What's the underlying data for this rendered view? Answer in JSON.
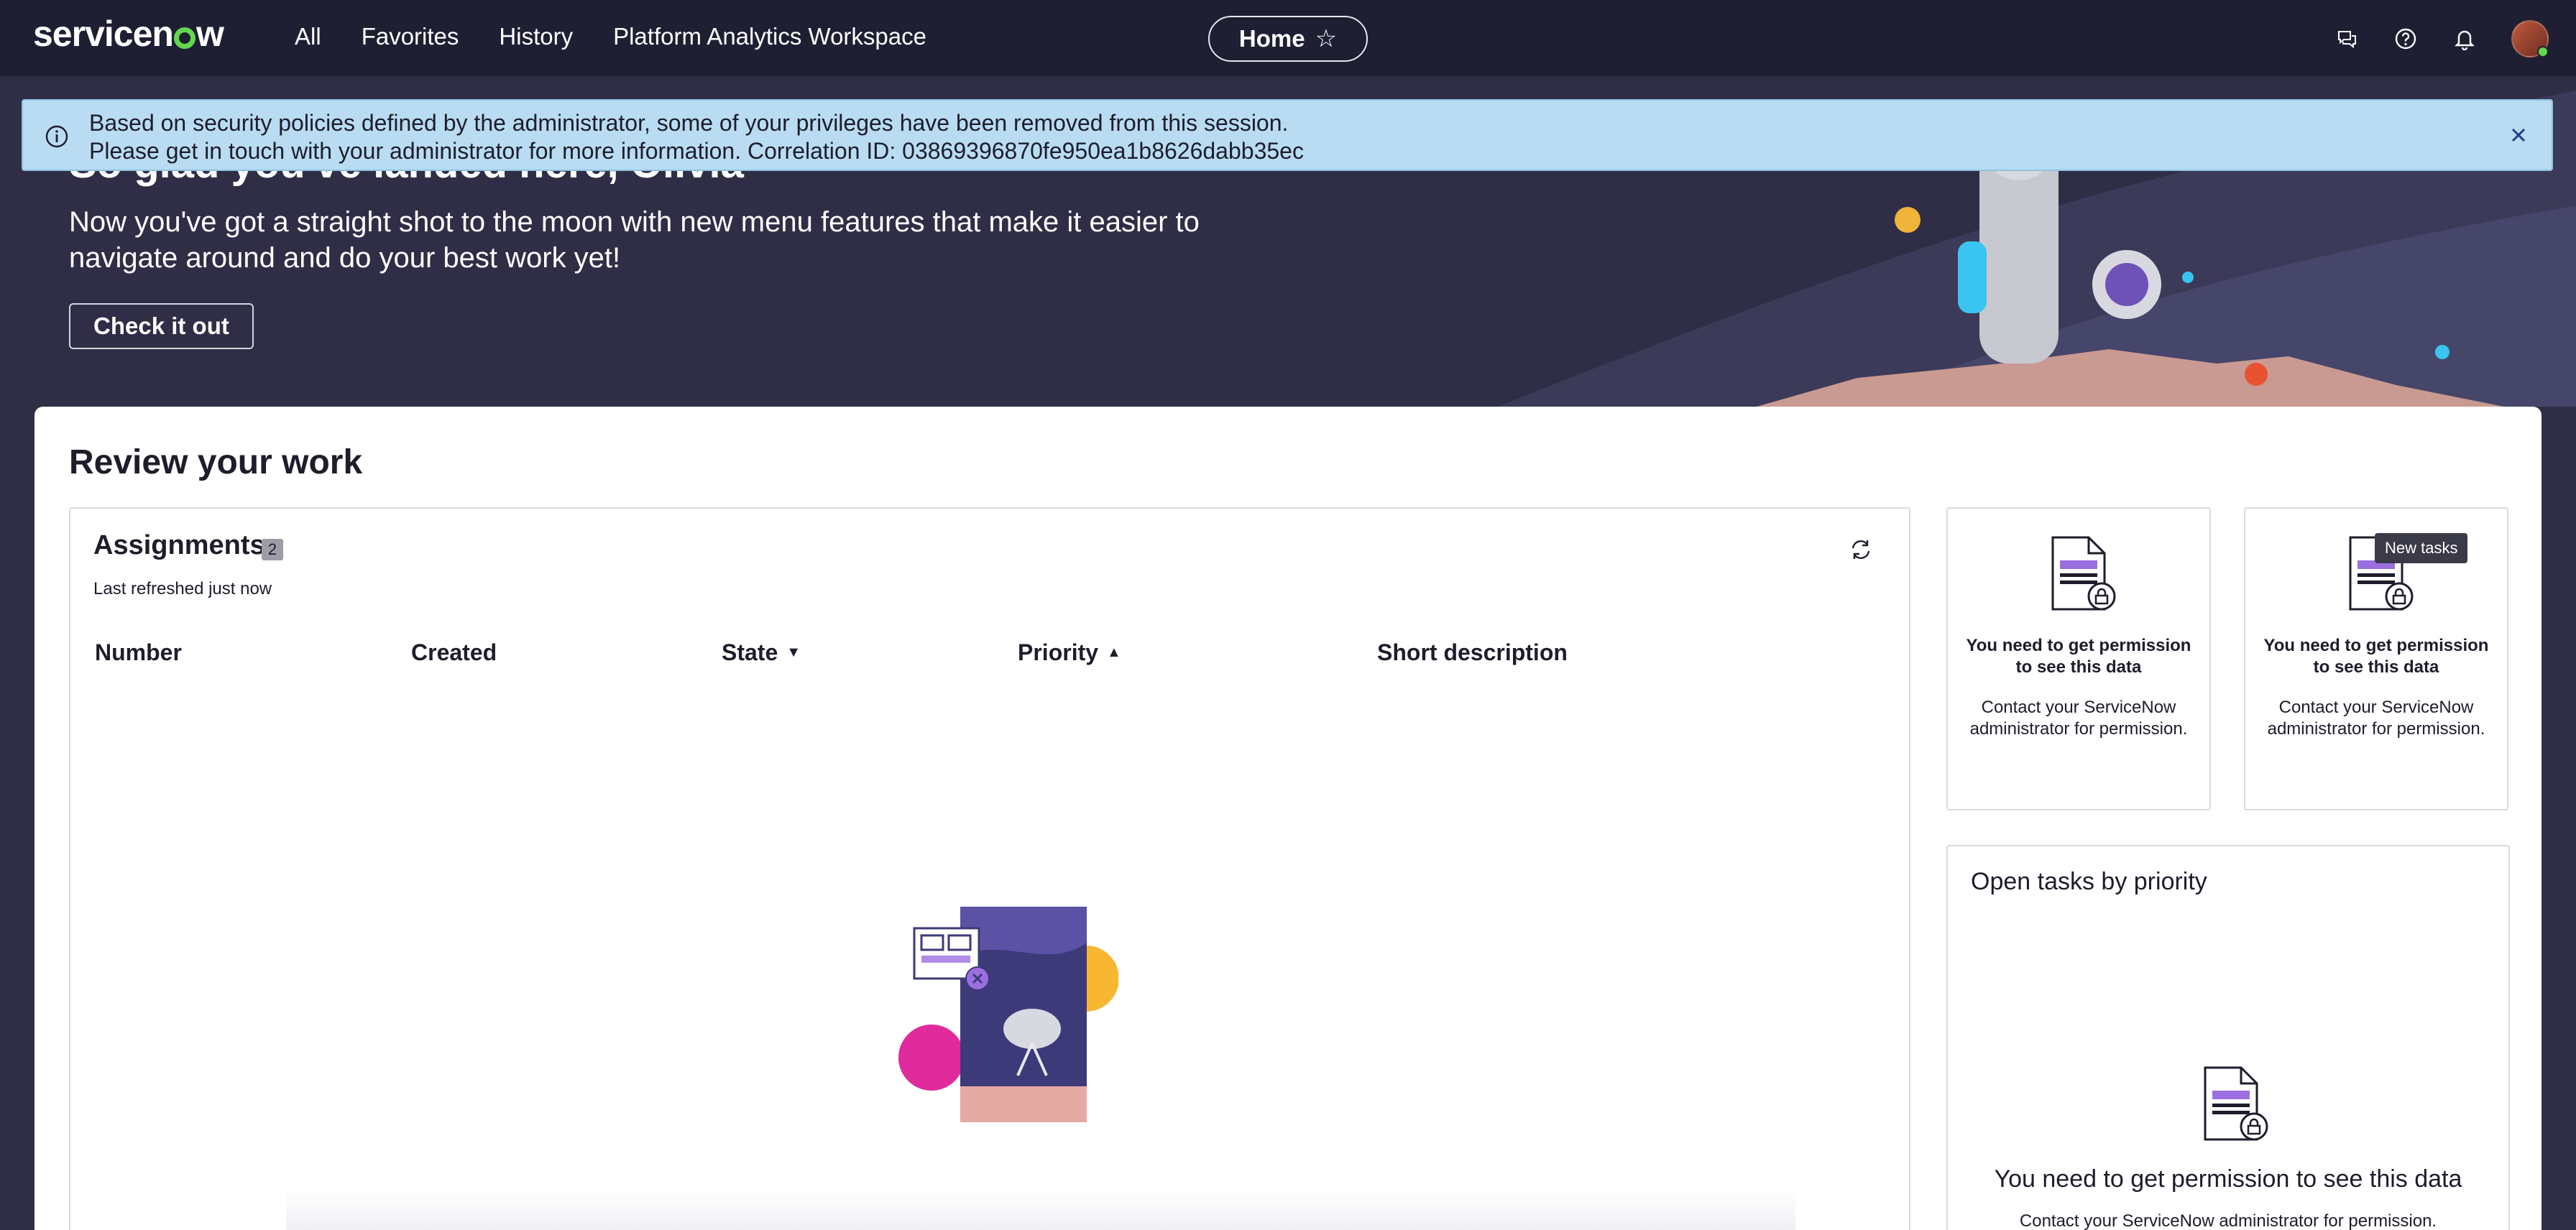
{
  "nav": {
    "logo": "servicenow",
    "links": [
      "All",
      "Favorites",
      "History",
      "Platform Analytics Workspace"
    ],
    "home_label": "Home",
    "icons": [
      "chat-icon",
      "help-icon",
      "bell-icon"
    ]
  },
  "hero": {
    "heading": "So glad you've landed here, Olivia",
    "subtitle": "Now you've got a straight shot to the moon with new menu features that make it easier to navigate around and do your best work yet!",
    "button": "Check it out"
  },
  "banner": {
    "line1": "Based on security policies defined by the administrator, some of your privileges have been removed from this session.",
    "line2": "Please get in touch with your administrator for more information. Correlation ID: 03869396870fe950ea1b8626dabb35ec"
  },
  "main": {
    "title": "Review your work",
    "assignments": {
      "title": "Assignments",
      "count": "2",
      "refreshed": "Last refreshed just now",
      "columns": [
        "Number",
        "Created",
        "State",
        "Priority",
        "Short description"
      ]
    },
    "perm_cards": [
      {
        "title": "You need to get permission to see this data",
        "body": "Contact your ServiceNow administrator for permission."
      },
      {
        "title": "You need to get permission to see this data",
        "body": "Contact your ServiceNow administrator for permission.",
        "tooltip": "New tasks"
      }
    ],
    "open_tasks": {
      "title": "Open tasks by priority",
      "message": "You need to get permission to see this data",
      "sub": "Contact your ServiceNow administrator for permission."
    }
  },
  "colors": {
    "nav_bg": "#1f1f33",
    "hero_bg": "#2f2e46",
    "banner_bg": "#b9dcf2",
    "accent_purple": "#8a5cd6",
    "brand_green": "#62d84e"
  }
}
